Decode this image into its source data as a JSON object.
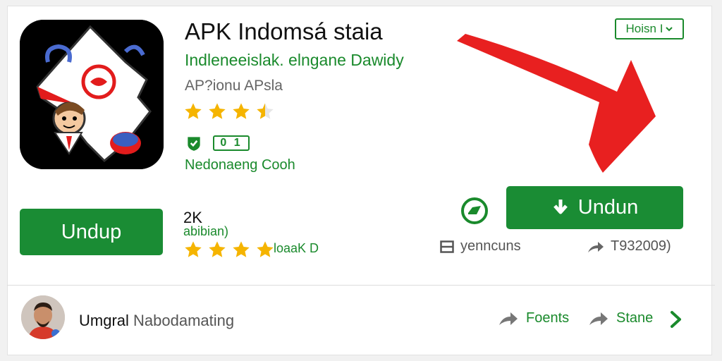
{
  "app": {
    "title": "APK Indomsá staia",
    "developer": "Indleneeislak. elngane Dawidy",
    "category": "AP?ionu APsla",
    "top_rating_stars": 3.5,
    "badge_box_text": "0 1",
    "in_app_text": "Nedonaeng Cooh"
  },
  "corner_tag": {
    "label": "Hoisn I"
  },
  "left_button": {
    "label": "Undup"
  },
  "rating": {
    "count": "2K",
    "sub": "abibian)",
    "stars": 4,
    "label": "loaaK D"
  },
  "right_button": {
    "label": "Undun"
  },
  "meta": {
    "left_text": "yenncuns",
    "right_text": "T932009)"
  },
  "user": {
    "first_name": "Umgral",
    "second_name": "Nabodamating"
  },
  "footer": {
    "action1_label": "Foents",
    "action2_label": "Stane"
  },
  "colors": {
    "primary_green": "#1a8c34",
    "star": "#f5b400",
    "arrow": "#e82020"
  }
}
